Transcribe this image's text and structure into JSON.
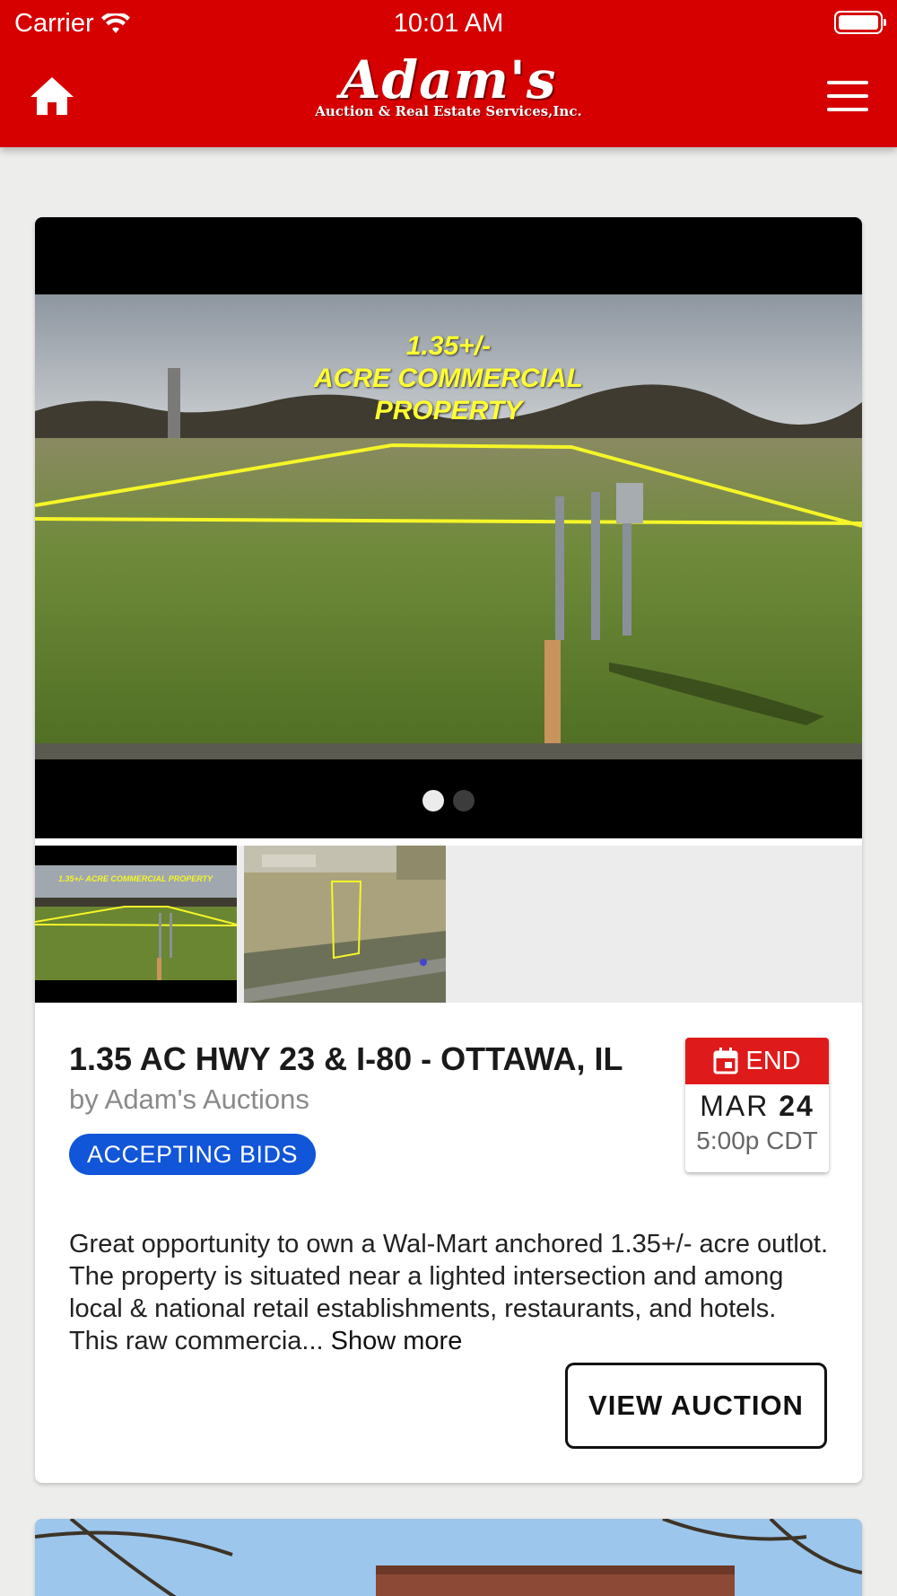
{
  "status_bar": {
    "carrier": "Carrier",
    "time": "10:01 AM"
  },
  "header": {
    "logo_main": "Adam's",
    "logo_sub": "Auction & Real Estate Services,Inc."
  },
  "listing": {
    "photo_overlay": {
      "line1": "1.35+/-",
      "line2": "ACRE COMMERCIAL",
      "line3": "PROPERTY"
    },
    "thumbnail_overlay": "1.35+/- ACRE COMMERCIAL PROPERTY",
    "title": "1.35 AC HWY 23 & I-80 - OTTAWA, IL",
    "byline": "by Adam's Auctions",
    "status_badge": "ACCEPTING BIDS",
    "end_date": {
      "label": "END",
      "month": "MAR",
      "day": "24",
      "time": "5:00p CDT"
    },
    "description": "Great opportunity to own a Wal-Mart anchored 1.35+/- acre outlot. The property is situated near a lighted intersection and among local & national retail establishments, restaurants, and hotels. This raw commercia...",
    "show_more": "Show more",
    "view_button": "VIEW AUCTION"
  },
  "colors": {
    "brand_red": "#d60000",
    "badge_blue": "#1155d9",
    "date_red": "#df1a1a"
  },
  "icons": [
    "wifi-icon",
    "battery-icon",
    "home-icon",
    "hamburger-menu-icon",
    "calendar-icon"
  ]
}
